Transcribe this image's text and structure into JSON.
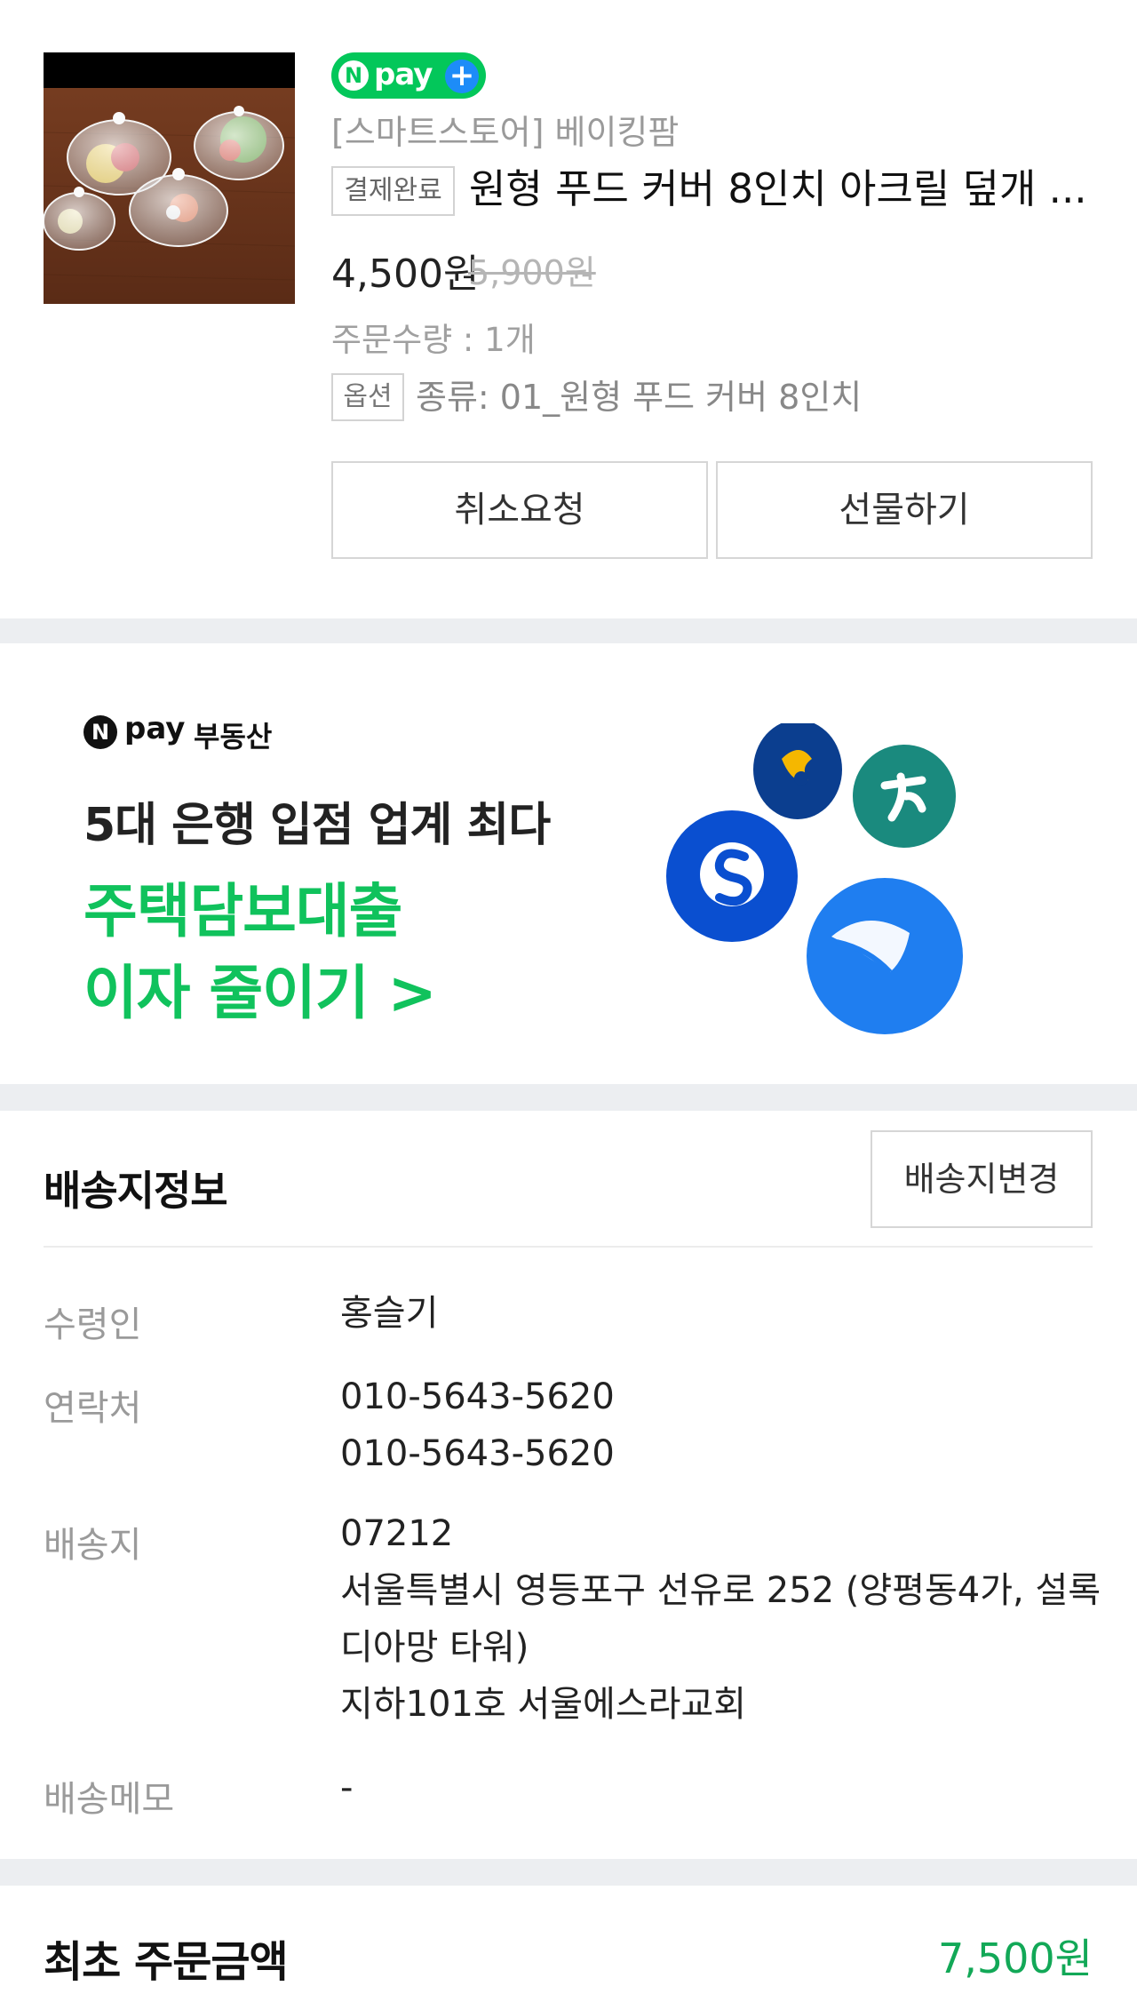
{
  "product": {
    "npay_badge": "pay",
    "store": "[스마트스토어] 베이킹팜",
    "status": "결제완료",
    "title": "원형 푸드 커버 8인치 아크릴 덮개 ...",
    "price": "4,500원",
    "original_price": "5,900원",
    "quantity": "주문수량 : 1개",
    "option_badge": "옵션",
    "option_text": "종류: 01_원형 푸드 커버 8인치",
    "cancel_label": "취소요청",
    "gift_label": "선물하기"
  },
  "banner": {
    "brand_pay": "pay",
    "brand_re": "부동산",
    "line1": "5대 은행 입점 업계 최다",
    "line2": "주택담보대출",
    "line3": "이자 줄이기 >"
  },
  "delivery": {
    "title": "배송지정보",
    "change_label": "배송지변경",
    "recipient_label": "수령인",
    "recipient": "홍슬기",
    "contact_label": "연락처",
    "phone1": "010-5643-5620",
    "phone2": "010-5643-5620",
    "address_label": "배송지",
    "zipcode": "07212",
    "address1": "서울특별시 영등포구 선유로 252 (양평동4가, 설록",
    "address2": "디아망 타워)",
    "address3": "지하101호 서울에스라교회",
    "memo_label": "배송메모",
    "memo": "-"
  },
  "total": {
    "label": "최초 주문금액",
    "value": "7,500원"
  },
  "colors": {
    "naver_green": "#03c75a",
    "banner_green": "#10c25c",
    "amount_green": "#12a857",
    "divider": "#eceef1"
  }
}
